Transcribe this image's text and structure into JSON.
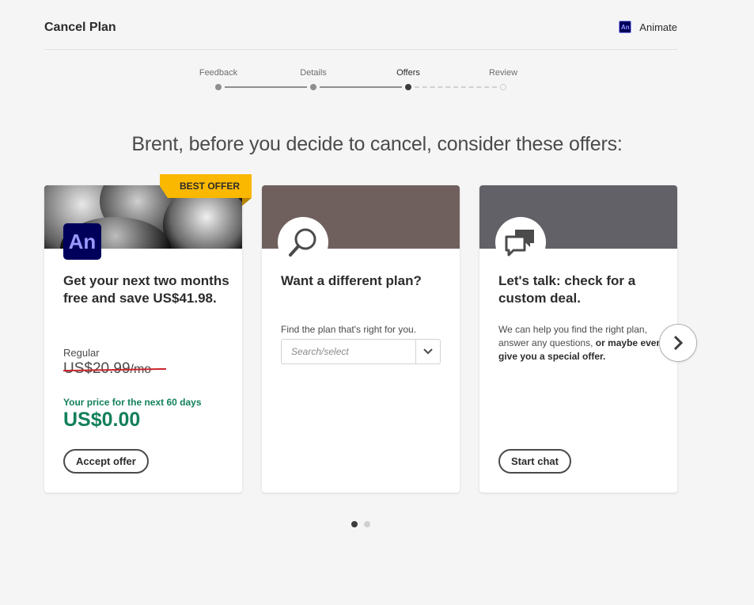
{
  "header": {
    "title": "Cancel Plan",
    "app_name": "Animate",
    "app_badge_text": "An"
  },
  "stepper": {
    "steps": [
      {
        "label": "Feedback",
        "state": "done"
      },
      {
        "label": "Details",
        "state": "done"
      },
      {
        "label": "Offers",
        "state": "current"
      },
      {
        "label": "Review",
        "state": "future"
      }
    ]
  },
  "headline": "Brent, before you decide to cancel, consider these offers:",
  "offers": [
    {
      "ribbon": "BEST OFFER",
      "logo_text": "An",
      "title": "Get your next two months free and save US$41.98.",
      "regular_label": "Regular",
      "old_price": "US$20.99",
      "old_price_unit": "/mo",
      "promo_label": "Your price for the next 60 days",
      "promo_price": "US$0.00",
      "button": "Accept offer"
    },
    {
      "title": "Want a different plan?",
      "description": "Find the plan that's right for you.",
      "select_placeholder": "Search/select",
      "banner_color": "#6f605e"
    },
    {
      "title": "Let's talk: check for a custom deal.",
      "description_plain": "We can help you find the right plan, answer any questions, ",
      "description_bold": "or maybe even give you a special offer.",
      "button": "Start chat",
      "banner_color": "#626168"
    }
  ],
  "pager": {
    "count": 2,
    "active": 1
  },
  "colors": {
    "promo_green": "#12805c",
    "ribbon_yellow": "#fbb800",
    "animate_navy": "#00005b",
    "animate_lilac": "#9999ff",
    "strike_red": "#c9252c"
  },
  "icons": [
    "magnifier-icon",
    "chat-bubbles-icon",
    "chevron-down-icon",
    "chevron-right-icon"
  ]
}
